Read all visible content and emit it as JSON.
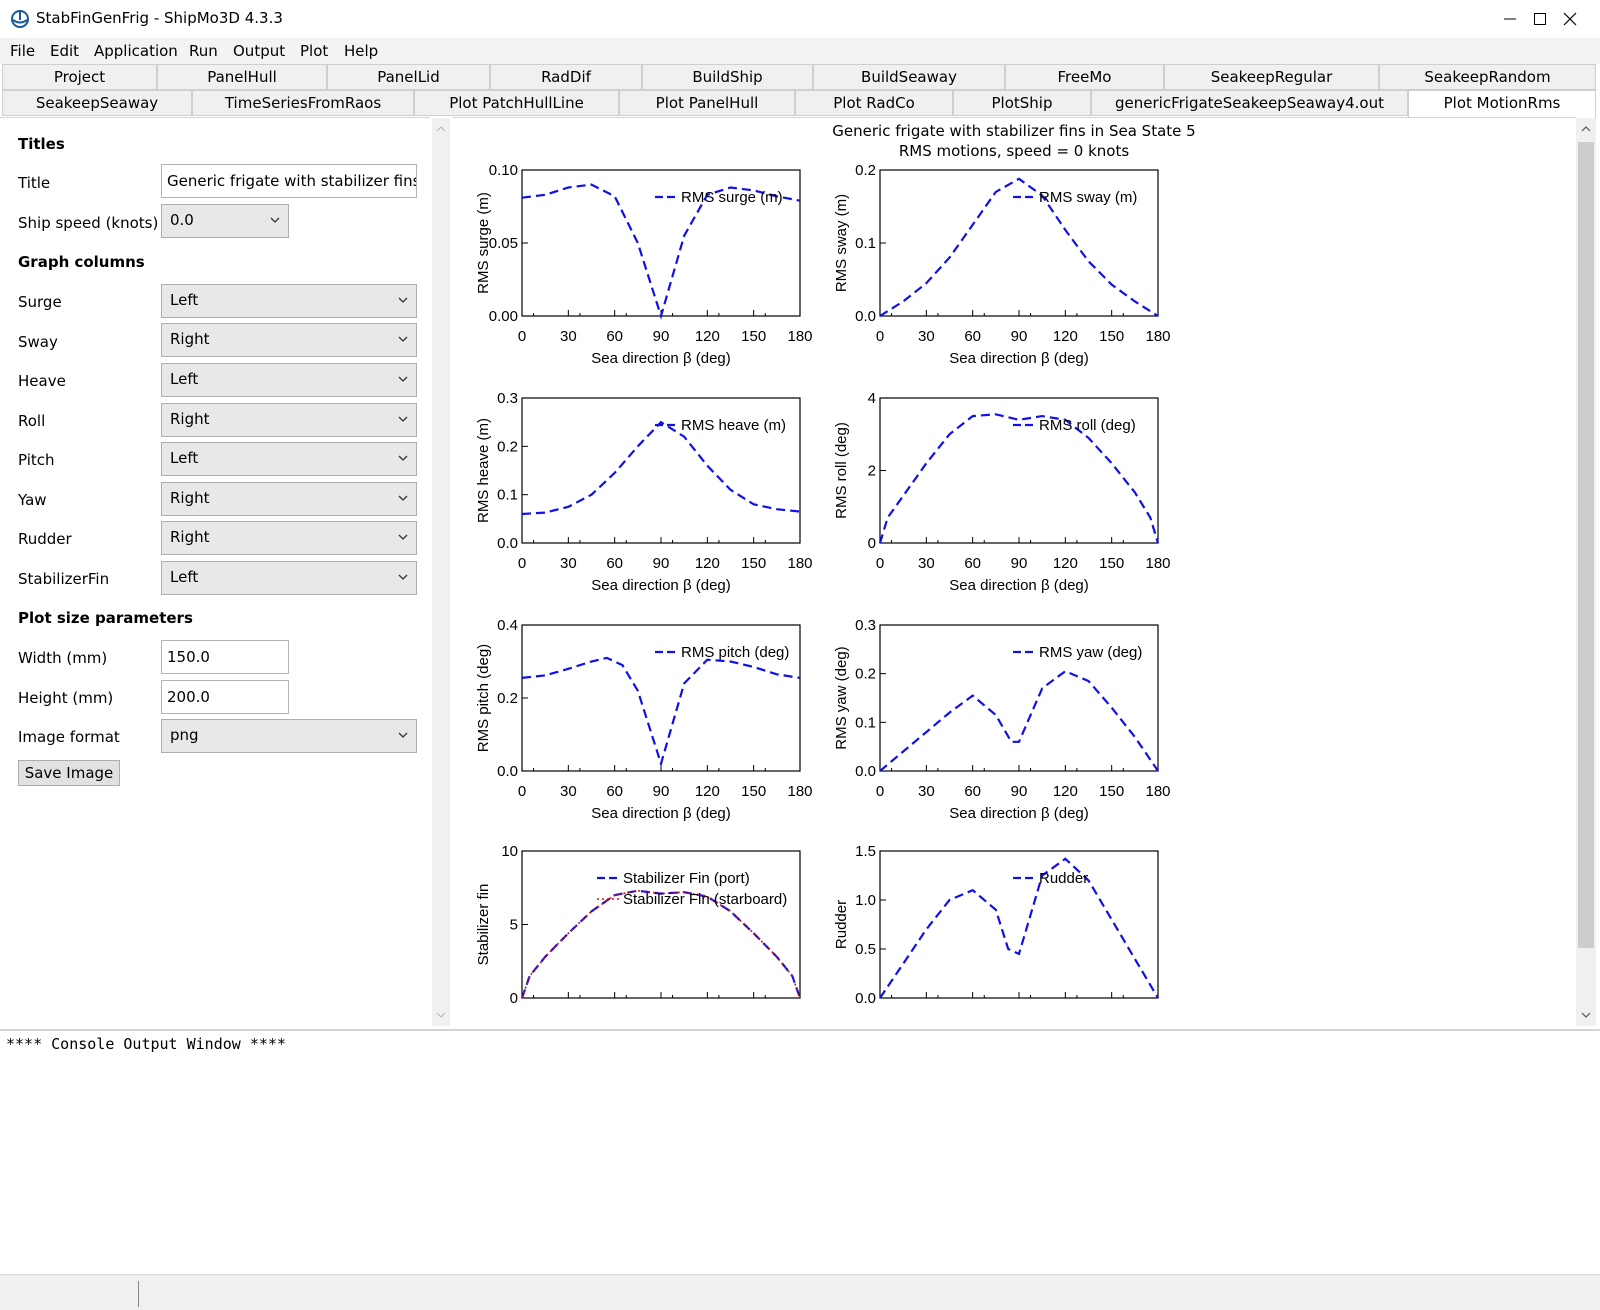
{
  "window": {
    "title": "StabFinGenFrig - ShipMo3D 4.3.3"
  },
  "menu": [
    "File",
    "Edit",
    "Application",
    "Run",
    "Output",
    "Plot",
    "Help"
  ],
  "tabs_row1": [
    "Project",
    "PanelHull",
    "PanelLid",
    "RadDif",
    "BuildShip",
    "BuildSeaway",
    "FreeMo",
    "SeakeepRegular",
    "SeakeepRandom"
  ],
  "tabs_row2": [
    "SeakeepSeaway",
    "TimeSeriesFromRaos",
    "Plot PatchHullLine",
    "Plot PanelHull",
    "Plot RadCo",
    "PlotShip",
    "genericFrigateSeakeepSeaway4.out",
    "Plot MotionRms"
  ],
  "form": {
    "titles_heading": "Titles",
    "title_label": "Title",
    "title_value": "Generic frigate with stabilizer fins in S",
    "speed_label": "Ship speed (knots)",
    "speed_value": "0.0",
    "graph_columns_heading": "Graph columns",
    "columns": [
      {
        "label": "Surge",
        "value": "Left"
      },
      {
        "label": "Sway",
        "value": "Right"
      },
      {
        "label": "Heave",
        "value": "Left"
      },
      {
        "label": "Roll",
        "value": "Right"
      },
      {
        "label": "Pitch",
        "value": "Left"
      },
      {
        "label": "Yaw",
        "value": "Right"
      },
      {
        "label": "Rudder",
        "value": "Right"
      },
      {
        "label": "StabilizerFin",
        "value": "Left"
      }
    ],
    "plot_size_heading": "Plot size parameters",
    "width_label": "Width (mm)",
    "width_value": "150.0",
    "height_label": "Height (mm)",
    "height_value": "200.0",
    "format_label": "Image format",
    "format_value": "png",
    "save_button": "Save Image"
  },
  "plot": {
    "title_line1": "Generic frigate with stabilizer fins in Sea State 5",
    "title_line2": "RMS motions, speed = 0 knots"
  },
  "console": {
    "text": "**** Console Output Window ****"
  },
  "colors": {
    "series_blue": "#1010e8",
    "series_red": "#d01010",
    "series_purple": "#8020a0"
  },
  "chart_data": [
    {
      "type": "line",
      "xlabel": "Sea direction β (deg)",
      "ylabel": "RMS surge (m)",
      "xlim": [
        0,
        180
      ],
      "ylim": [
        0,
        0.1
      ],
      "yticks": [
        "0.00",
        "0.05",
        "0.10"
      ],
      "legend": "top-right",
      "series": [
        {
          "name": "RMS surge (m)",
          "x": [
            0,
            15,
            30,
            45,
            60,
            75,
            90,
            105,
            120,
            135,
            150,
            165,
            180
          ],
          "values": [
            0.081,
            0.083,
            0.088,
            0.09,
            0.082,
            0.05,
            0.0,
            0.055,
            0.083,
            0.088,
            0.086,
            0.082,
            0.079
          ]
        }
      ]
    },
    {
      "type": "line",
      "xlabel": "Sea direction β (deg)",
      "ylabel": "RMS sway (m)",
      "xlim": [
        0,
        180
      ],
      "ylim": [
        0,
        0.2
      ],
      "yticks": [
        "0.0",
        "0.1",
        "0.2"
      ],
      "legend": "top-right",
      "series": [
        {
          "name": "RMS sway (m)",
          "x": [
            0,
            15,
            30,
            45,
            60,
            75,
            90,
            105,
            120,
            135,
            150,
            165,
            180
          ],
          "values": [
            0.0,
            0.02,
            0.045,
            0.08,
            0.125,
            0.17,
            0.188,
            0.165,
            0.118,
            0.075,
            0.043,
            0.02,
            0.0
          ]
        }
      ]
    },
    {
      "type": "line",
      "xlabel": "Sea direction β (deg)",
      "ylabel": "RMS heave (m)",
      "xlim": [
        0,
        180
      ],
      "ylim": [
        0,
        0.3
      ],
      "yticks": [
        "0.0",
        "0.1",
        "0.2",
        "0.3"
      ],
      "legend": "top-right",
      "series": [
        {
          "name": "RMS heave (m)",
          "x": [
            0,
            15,
            30,
            45,
            60,
            75,
            90,
            105,
            120,
            135,
            150,
            165,
            180
          ],
          "values": [
            0.06,
            0.063,
            0.075,
            0.1,
            0.145,
            0.2,
            0.25,
            0.22,
            0.16,
            0.11,
            0.08,
            0.07,
            0.065
          ]
        }
      ]
    },
    {
      "type": "line",
      "xlabel": "Sea direction β (deg)",
      "ylabel": "RMS roll (deg)",
      "xlim": [
        0,
        180
      ],
      "ylim": [
        0,
        4
      ],
      "yticks": [
        "0",
        "2",
        "4"
      ],
      "legend": "top-right",
      "series": [
        {
          "name": "RMS roll (deg)",
          "x": [
            0,
            5,
            15,
            30,
            45,
            60,
            75,
            90,
            105,
            120,
            135,
            150,
            165,
            175,
            180
          ],
          "values": [
            0.0,
            0.7,
            1.3,
            2.2,
            3.0,
            3.5,
            3.55,
            3.4,
            3.5,
            3.4,
            2.9,
            2.2,
            1.4,
            0.7,
            0.0
          ]
        }
      ]
    },
    {
      "type": "line",
      "xlabel": "Sea direction β (deg)",
      "ylabel": "RMS pitch (deg)",
      "xlim": [
        0,
        180
      ],
      "ylim": [
        0,
        0.4
      ],
      "yticks": [
        "0.0",
        "0.2",
        "0.4"
      ],
      "legend": "top-right",
      "series": [
        {
          "name": "RMS pitch (deg)",
          "x": [
            0,
            15,
            30,
            45,
            55,
            65,
            75,
            90,
            105,
            120,
            135,
            150,
            165,
            180
          ],
          "values": [
            0.255,
            0.262,
            0.28,
            0.3,
            0.31,
            0.29,
            0.22,
            0.02,
            0.24,
            0.305,
            0.3,
            0.285,
            0.265,
            0.255
          ]
        }
      ]
    },
    {
      "type": "line",
      "xlabel": "Sea direction β (deg)",
      "ylabel": "RMS yaw (deg)",
      "xlim": [
        0,
        180
      ],
      "ylim": [
        0,
        0.3
      ],
      "yticks": [
        "0.0",
        "0.1",
        "0.2",
        "0.3"
      ],
      "legend": "top-right",
      "series": [
        {
          "name": "RMS yaw (deg)",
          "x": [
            0,
            15,
            30,
            45,
            60,
            75,
            85,
            90,
            105,
            120,
            135,
            150,
            165,
            180
          ],
          "values": [
            0.0,
            0.04,
            0.08,
            0.12,
            0.155,
            0.115,
            0.06,
            0.06,
            0.17,
            0.205,
            0.185,
            0.13,
            0.07,
            0.0
          ]
        }
      ]
    },
    {
      "type": "line",
      "xlabel": "",
      "ylabel": "Stabilizer fin",
      "xlim": [
        0,
        180
      ],
      "ylim": [
        0,
        10
      ],
      "yticks": [
        "0",
        "5",
        "10"
      ],
      "legend": "top",
      "series": [
        {
          "name": "Stabilizer Fin (port)",
          "x": [
            0,
            5,
            15,
            30,
            45,
            60,
            75,
            90,
            105,
            120,
            135,
            150,
            165,
            175,
            180
          ],
          "values": [
            0.0,
            1.5,
            2.8,
            4.4,
            5.9,
            7.0,
            7.3,
            7.1,
            7.2,
            6.9,
            5.9,
            4.4,
            2.8,
            1.5,
            0.0
          ]
        },
        {
          "name": "Stabilizer Fin (starboard)",
          "x": [
            0,
            5,
            15,
            30,
            45,
            60,
            75,
            90,
            105,
            120,
            135,
            150,
            165,
            175,
            180
          ],
          "values": [
            0.0,
            1.5,
            2.8,
            4.4,
            5.9,
            7.0,
            7.3,
            7.1,
            7.2,
            6.9,
            5.9,
            4.4,
            2.8,
            1.5,
            0.0
          ]
        }
      ]
    },
    {
      "type": "line",
      "xlabel": "",
      "ylabel": "Rudder",
      "xlim": [
        0,
        180
      ],
      "ylim": [
        0,
        1.5
      ],
      "yticks": [
        "0.0",
        "0.5",
        "1.0",
        "1.5"
      ],
      "legend": "top-right",
      "series": [
        {
          "name": "Rudder",
          "x": [
            0,
            15,
            30,
            45,
            60,
            75,
            83,
            90,
            105,
            120,
            135,
            150,
            165,
            180
          ],
          "values": [
            0.0,
            0.35,
            0.7,
            1.0,
            1.1,
            0.9,
            0.5,
            0.45,
            1.25,
            1.42,
            1.2,
            0.8,
            0.4,
            0.0
          ]
        }
      ]
    }
  ]
}
